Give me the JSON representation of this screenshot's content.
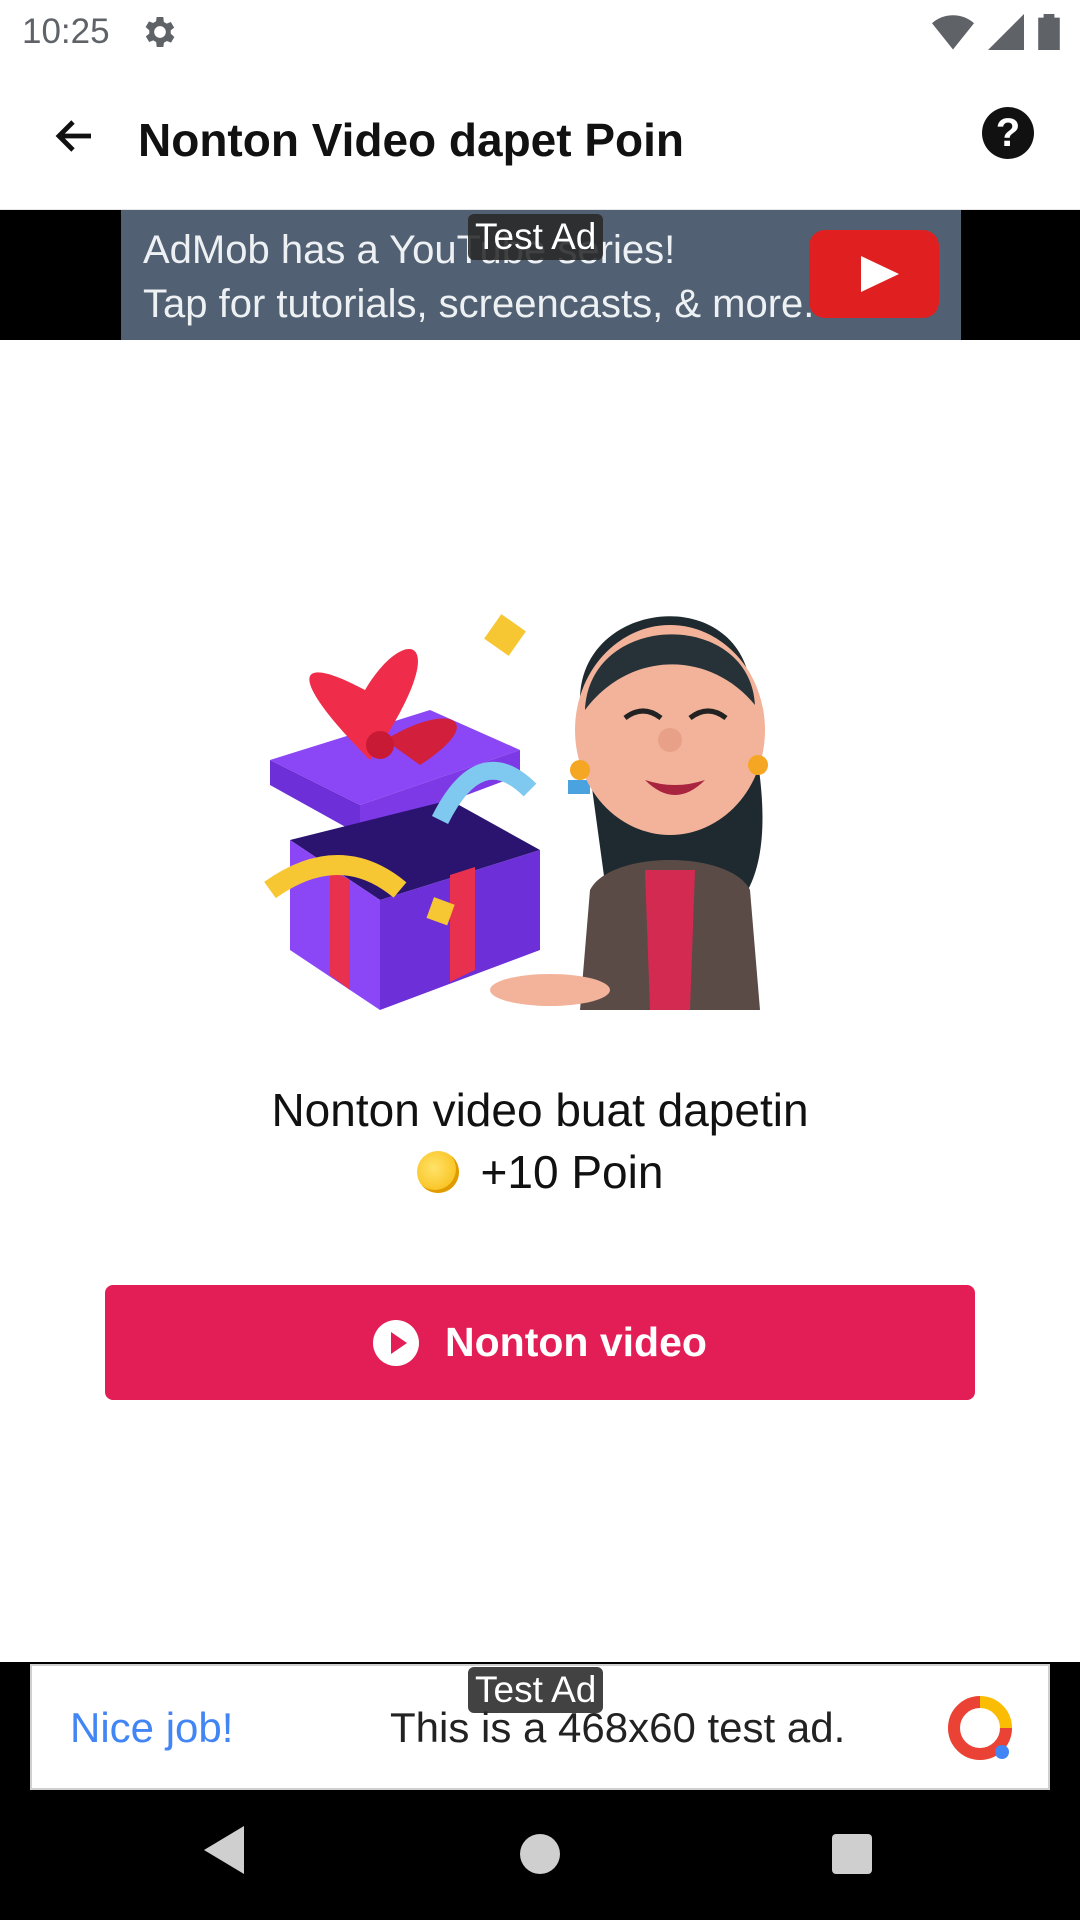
{
  "status_bar": {
    "time": "10:25"
  },
  "app_bar": {
    "title": "Nonton Video dapet Poin"
  },
  "top_ad": {
    "line1": "AdMob has a YouTube series!",
    "line2": "Tap for tutorials, screencasts, & more.",
    "badge": "Test Ad"
  },
  "reward": {
    "line1": "Nonton video buat dapetin",
    "points": "+10 Poin"
  },
  "watch_button": {
    "label": "Nonton video"
  },
  "bottom_ad": {
    "nice": "Nice job!",
    "text": "This is a 468x60 test ad.",
    "badge": "Test Ad"
  },
  "colors": {
    "accent": "#e31e56",
    "ad_bg": "#516072",
    "nice_text": "#4285f4"
  }
}
